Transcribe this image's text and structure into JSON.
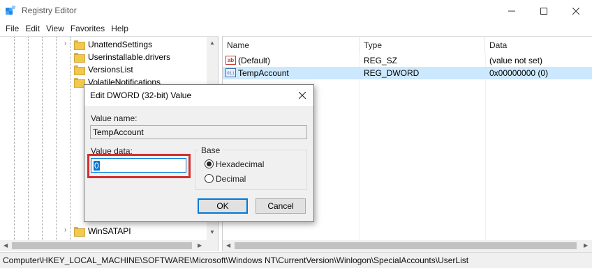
{
  "window": {
    "title": "Registry Editor",
    "menu": [
      "File",
      "Edit",
      "View",
      "Favorites",
      "Help"
    ]
  },
  "tree": {
    "items": [
      {
        "label": "UnattendSettings",
        "expander": "›"
      },
      {
        "label": "Userinstallable.drivers",
        "expander": ""
      },
      {
        "label": "VersionsList",
        "expander": ""
      },
      {
        "label": "VolatileNotifications",
        "expander": ""
      },
      {
        "label": "WinSATAPI",
        "expander": "›"
      }
    ]
  },
  "list": {
    "columns": {
      "name": "Name",
      "type": "Type",
      "data": "Data"
    },
    "rows": [
      {
        "icon": "string-value-icon",
        "name": "(Default)",
        "type": "REG_SZ",
        "data": "(value not set)",
        "selected": false
      },
      {
        "icon": "dword-value-icon",
        "name": "TempAccount",
        "type": "REG_DWORD",
        "data": "0x00000000 (0)",
        "selected": true
      }
    ]
  },
  "statusbar": {
    "path": "Computer\\HKEY_LOCAL_MACHINE\\SOFTWARE\\Microsoft\\Windows NT\\CurrentVersion\\Winlogon\\SpecialAccounts\\UserList"
  },
  "dialog": {
    "title": "Edit DWORD (32-bit) Value",
    "value_name_label": "Value name:",
    "value_name": "TempAccount",
    "value_data_label": "Value data:",
    "value_data": "0",
    "base_label": "Base",
    "radio_hex": "Hexadecimal",
    "radio_dec": "Decimal",
    "selected_base": "Hexadecimal",
    "ok_label": "OK",
    "cancel_label": "Cancel"
  },
  "colors": {
    "selection": "#cce8ff",
    "accent": "#0078d7",
    "highlight_box": "#d32f2f",
    "folder": "#f1c94e"
  }
}
